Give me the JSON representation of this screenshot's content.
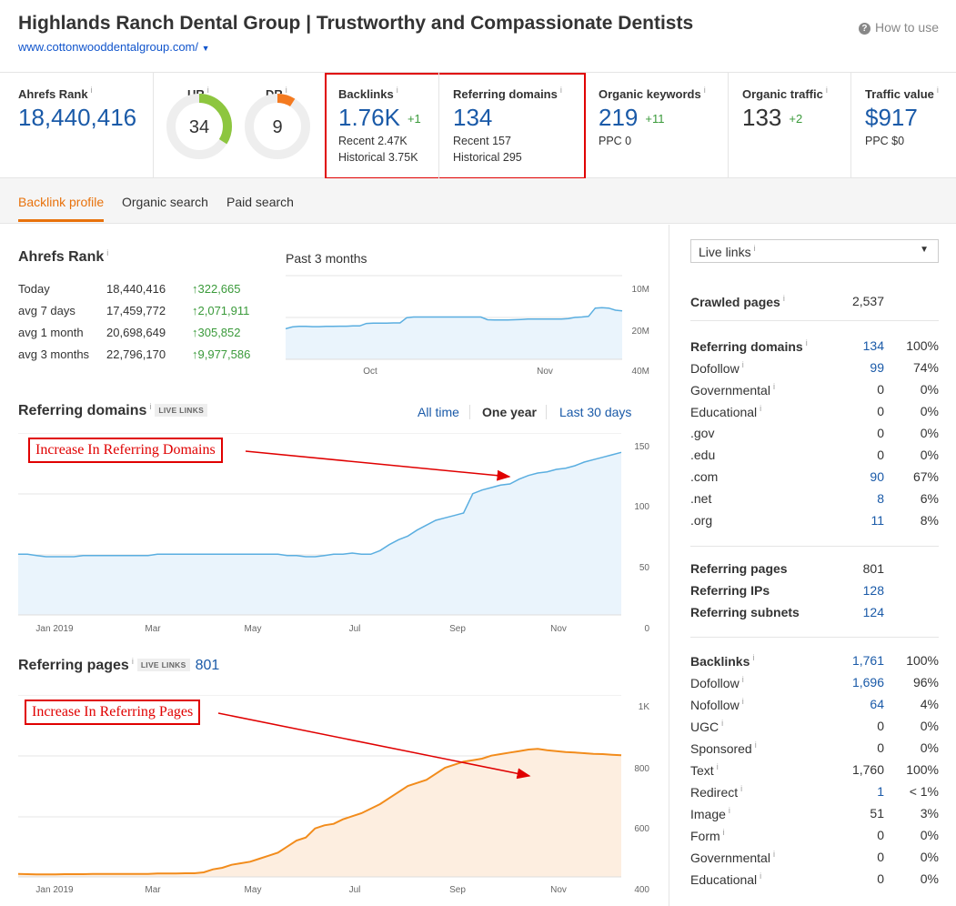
{
  "header": {
    "title": "Highlands Ranch Dental Group | Trustworthy and Compassionate Dentists",
    "url": "www.cottonwooddentalgroup.com/",
    "how_to_use": "How to use"
  },
  "metrics": {
    "ahrefs_rank": {
      "label": "Ahrefs Rank",
      "value": "18,440,416"
    },
    "ur": {
      "label": "UR",
      "value": "34",
      "level": 0.34,
      "color": "#8dc63f"
    },
    "dr": {
      "label": "DR",
      "value": "9",
      "level": 0.09,
      "color": "#f47a20"
    },
    "backlinks": {
      "label": "Backlinks",
      "value": "1.76K",
      "delta": "+1",
      "recent": "Recent 2.47K",
      "historical": "Historical 3.75K"
    },
    "referring_domains": {
      "label": "Referring domains",
      "value": "134",
      "recent": "Recent 157",
      "historical": "Historical 295"
    },
    "organic_keywords": {
      "label": "Organic keywords",
      "value": "219",
      "delta": "+11",
      "ppc": "PPC 0"
    },
    "organic_traffic": {
      "label": "Organic traffic",
      "value": "133",
      "delta": "+2"
    },
    "traffic_value": {
      "label": "Traffic value",
      "value": "$917",
      "ppc": "PPC $0"
    }
  },
  "tabs": [
    "Backlink profile",
    "Organic search",
    "Paid search"
  ],
  "ahrefs_rank_section": {
    "title": "Ahrefs Rank",
    "rows": [
      {
        "label": "Today",
        "value": "18,440,416",
        "change": "322,665"
      },
      {
        "label": "avg 7 days",
        "value": "17,459,772",
        "change": "2,071,911"
      },
      {
        "label": "avg 1 month",
        "value": "20,698,649",
        "change": "305,852"
      },
      {
        "label": "avg 3 months",
        "value": "22,796,170",
        "change": "9,977,586"
      }
    ],
    "chart_title": "Past 3 months"
  },
  "referring_domains_section": {
    "title": "Referring domains",
    "live": "LIVE LINKS",
    "ranges": [
      "All time",
      "One year",
      "Last 30 days"
    ],
    "annotation": "Increase In Referring Domains"
  },
  "referring_pages_section": {
    "title": "Referring pages",
    "live": "LIVE LINKS",
    "count": "801",
    "annotation": "Increase In Referring Pages"
  },
  "chart_data": [
    {
      "type": "area",
      "title": "Past 3 months",
      "x_ticks": [
        "Oct",
        "Nov"
      ],
      "y_ticks": [
        "10M",
        "20M",
        "40M"
      ],
      "y_scale": "log",
      "y_inverted": true,
      "ylim": [
        10000000,
        40000000
      ],
      "color": "#5aaee0",
      "values": [
        24500000,
        23800000,
        23600000,
        23600000,
        23700000,
        23700000,
        23600000,
        23600000,
        23500000,
        23500000,
        23400000,
        23400000,
        22500000,
        22400000,
        22400000,
        22400000,
        22300000,
        22300000,
        20500000,
        20300000,
        20300000,
        20300000,
        20300000,
        20300000,
        20300000,
        20300000,
        20300000,
        20300000,
        20300000,
        20300000,
        21200000,
        21300000,
        21300000,
        21300000,
        21200000,
        21100000,
        21000000,
        21000000,
        21000000,
        21000000,
        21000000,
        21000000,
        20800000,
        20400000,
        20300000,
        20100000,
        17600000,
        17500000,
        17600000,
        18200000,
        18400000
      ]
    },
    {
      "type": "area",
      "title": "Referring domains",
      "x_ticks": [
        "Jan 2019",
        "Mar",
        "May",
        "Jul",
        "Sep",
        "Nov"
      ],
      "y_ticks": [
        "150",
        "100",
        "50",
        "0"
      ],
      "ylim": [
        0,
        150
      ],
      "color": "#5aaee0",
      "values": [
        50,
        50,
        49,
        48,
        48,
        48,
        48,
        49,
        49,
        49,
        49,
        49,
        49,
        49,
        49,
        50,
        50,
        50,
        50,
        50,
        50,
        50,
        50,
        50,
        50,
        50,
        50,
        50,
        50,
        49,
        49,
        48,
        48,
        49,
        50,
        50,
        51,
        50,
        50,
        53,
        58,
        62,
        65,
        70,
        74,
        78,
        80,
        82,
        84,
        100,
        103,
        105,
        107,
        108,
        112,
        115,
        117,
        118,
        120,
        121,
        123,
        126,
        128,
        130,
        132,
        134
      ]
    },
    {
      "type": "area",
      "title": "Referring pages",
      "x_ticks": [
        "Jan 2019",
        "Mar",
        "May",
        "Jul",
        "Sep",
        "Nov"
      ],
      "y_ticks": [
        "1K",
        "800",
        "600",
        "400"
      ],
      "ylim": [
        400,
        1000
      ],
      "color": "#f28c1c",
      "values": [
        410,
        409,
        408,
        408,
        408,
        409,
        409,
        409,
        410,
        410,
        410,
        410,
        410,
        410,
        410,
        411,
        411,
        411,
        412,
        412,
        415,
        425,
        430,
        440,
        445,
        450,
        460,
        470,
        480,
        500,
        520,
        530,
        560,
        570,
        575,
        590,
        600,
        610,
        625,
        640,
        660,
        680,
        700,
        710,
        720,
        740,
        760,
        770,
        780,
        785,
        790,
        800,
        805,
        810,
        815,
        820,
        822,
        818,
        815,
        812,
        810,
        808,
        806,
        805,
        803,
        801
      ]
    }
  ],
  "right_panel": {
    "select_label": "Live links",
    "crawled": {
      "label": "Crawled pages",
      "value": "2,537"
    },
    "domains": [
      {
        "label": "Referring domains",
        "value": "134",
        "pct": "100%",
        "bold": true,
        "info": true,
        "blue": true
      },
      {
        "label": "Dofollow",
        "value": "99",
        "pct": "74%",
        "info": true,
        "blue": true
      },
      {
        "label": "Governmental",
        "value": "0",
        "pct": "0%",
        "info": true
      },
      {
        "label": "Educational",
        "value": "0",
        "pct": "0%",
        "info": true
      },
      {
        "label": ".gov",
        "value": "0",
        "pct": "0%"
      },
      {
        "label": ".edu",
        "value": "0",
        "pct": "0%"
      },
      {
        "label": ".com",
        "value": "90",
        "pct": "67%",
        "blue": true
      },
      {
        "label": ".net",
        "value": "8",
        "pct": "6%",
        "blue": true
      },
      {
        "label": ".org",
        "value": "11",
        "pct": "8%",
        "blue": true
      }
    ],
    "pages": [
      {
        "label": "Referring pages",
        "value": "801"
      },
      {
        "label": "Referring IPs",
        "value": "128",
        "blue": true
      },
      {
        "label": "Referring subnets",
        "value": "124",
        "blue": true
      }
    ],
    "backlinks": [
      {
        "label": "Backlinks",
        "value": "1,761",
        "pct": "100%",
        "bold": true,
        "info": true,
        "blue": true
      },
      {
        "label": "Dofollow",
        "value": "1,696",
        "pct": "96%",
        "info": true,
        "blue": true
      },
      {
        "label": "Nofollow",
        "value": "64",
        "pct": "4%",
        "info": true,
        "blue": true
      },
      {
        "label": "UGC",
        "value": "0",
        "pct": "0%",
        "info": true
      },
      {
        "label": "Sponsored",
        "value": "0",
        "pct": "0%",
        "info": true
      },
      {
        "label": "Text",
        "value": "1,760",
        "pct": "100%",
        "info": true
      },
      {
        "label": "Redirect",
        "value": "1",
        "pct": "< 1%",
        "info": true,
        "blue": true
      },
      {
        "label": "Image",
        "value": "51",
        "pct": "3%",
        "info": true
      },
      {
        "label": "Form",
        "value": "0",
        "pct": "0%",
        "info": true
      },
      {
        "label": "Governmental",
        "value": "0",
        "pct": "0%",
        "info": true
      },
      {
        "label": "Educational",
        "value": "0",
        "pct": "0%",
        "info": true
      }
    ]
  }
}
